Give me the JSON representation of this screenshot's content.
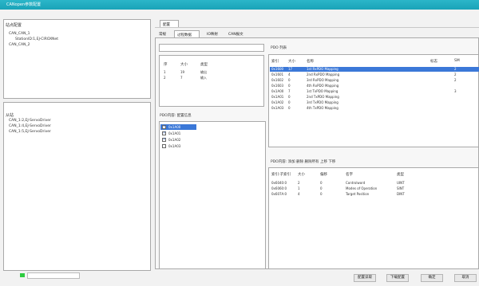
{
  "window": {
    "title": "CANopen参数配置"
  },
  "left_top": {
    "title": "站点配置",
    "tree": [
      "CAN_CAN_1",
      "StationID:1,EJ-CIROXNet",
      "CAN_CAN_2"
    ]
  },
  "left_bottom": {
    "title": "从站",
    "tree": [
      "CAN_1:2,EJ-ServoDriver",
      "CAN_1:4,EJ-ServoDriver",
      "CAN_1:5,EJ-ServoDriver"
    ]
  },
  "tabs": {
    "main": "配置",
    "sub": [
      "常规",
      "过程数据",
      "IO映射",
      "CAN报文"
    ]
  },
  "sizes_table": {
    "headers": [
      "序",
      "大小",
      "类型"
    ],
    "rows": [
      [
        "1",
        "19",
        "输出"
      ],
      [
        "2",
        "7",
        "输入"
      ]
    ]
  },
  "pdo_content_list": {
    "title": "PDO内容: 配置信息",
    "items": [
      {
        "label": "0x1A00",
        "checked": true,
        "selected": true
      },
      {
        "label": "0x1A01",
        "checked": true,
        "selected": false
      },
      {
        "label": "0x1A02",
        "checked": true,
        "selected": false
      },
      {
        "label": "0x1A03",
        "checked": false,
        "selected": false
      }
    ]
  },
  "pdo_list": {
    "title": "PDO 列表",
    "headers": [
      "索引",
      "大小",
      "名称",
      "标志",
      "SM"
    ],
    "rows": [
      [
        "0x1600",
        "17",
        "1st RxPDO Mapping",
        "",
        "2"
      ],
      [
        "0x1601",
        "4",
        "2nd RxPDO Mapping",
        "",
        "2"
      ],
      [
        "0x1602",
        "0",
        "3rd RxPDO Mapping",
        "",
        "2"
      ],
      [
        "0x1603",
        "0",
        "4th RxPDO Mapping",
        "",
        ""
      ],
      [
        "0x1A00",
        "7",
        "1st TxPDO Mapping",
        "",
        "3"
      ],
      [
        "0x1A01",
        "0",
        "2nd TxPDO Mapping",
        "",
        ""
      ],
      [
        "0x1A02",
        "0",
        "3rd TxPDO Mapping",
        "",
        ""
      ],
      [
        "0x1A03",
        "0",
        "4th TxPDO Mapping",
        "",
        ""
      ]
    ]
  },
  "pdo_edit": {
    "title": "PDO内容: 添加  删除  删除所有  上移  下移",
    "headers": [
      "索引:子索引",
      "大小",
      "偏移",
      "名字",
      "类型"
    ],
    "rows": [
      [
        "0x6040:0",
        "2",
        "0",
        "Controlword",
        "UINT"
      ],
      [
        "0x6060:0",
        "1",
        "0",
        "Modes of Operation",
        "SINT"
      ],
      [
        "0x607A:0",
        "4",
        "0",
        "Target Position",
        "DINT"
      ]
    ]
  },
  "buttons": [
    "配置读取",
    "下载配置",
    "确定",
    "取消"
  ],
  "colors": {
    "titlebar": "#1aa3b8",
    "selection": "#3b78d8"
  }
}
